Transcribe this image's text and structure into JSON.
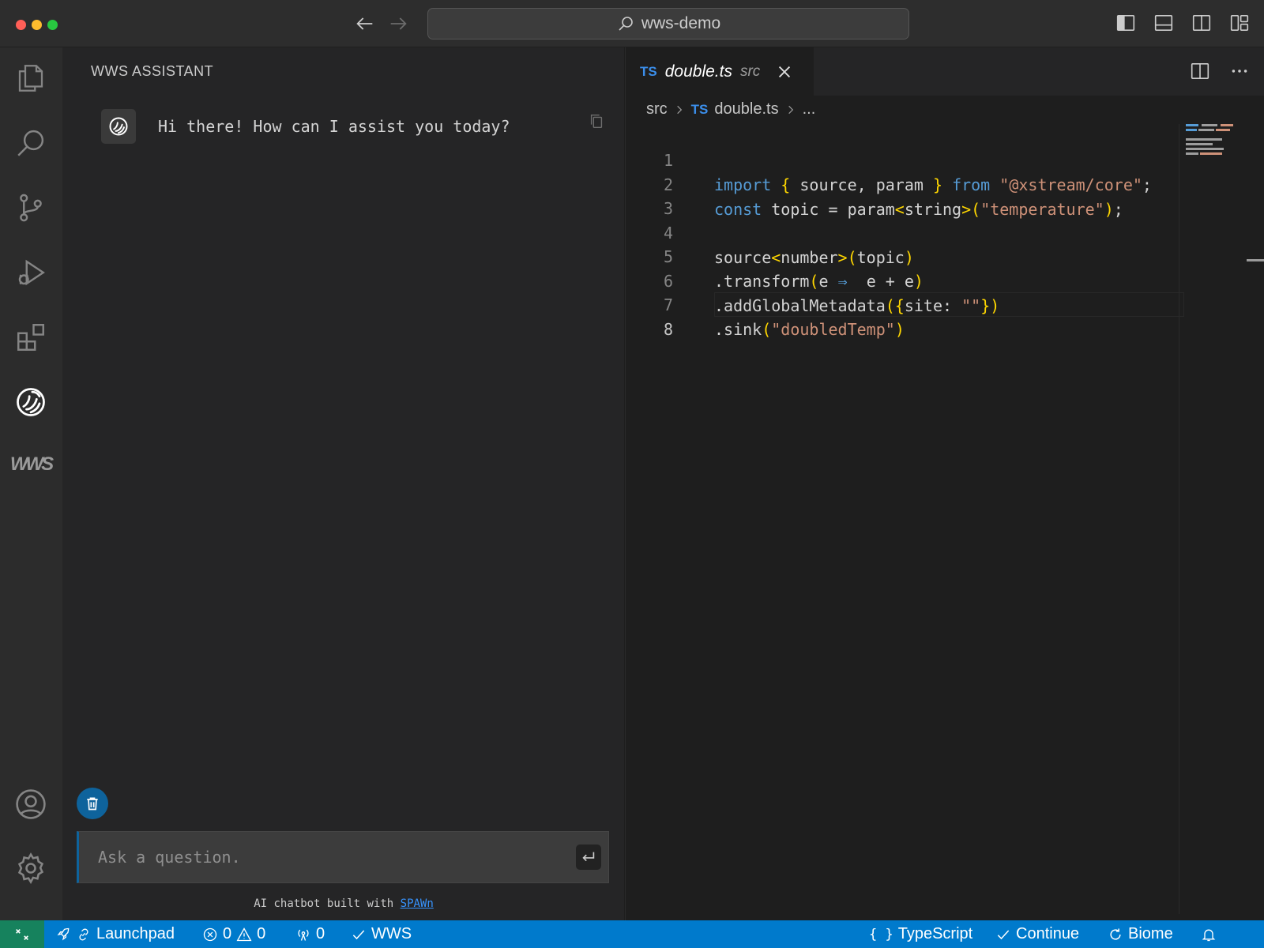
{
  "titlebar": {
    "search_text": "wws-demo"
  },
  "sidebar": {
    "title": "WWS ASSISTANT",
    "chat": {
      "bot_message": "Hi there! How can I assist you today?"
    },
    "input": {
      "placeholder": "Ask a question."
    },
    "footer": {
      "text": "AI chatbot built with ",
      "link": "SPAWn"
    }
  },
  "activitybar": {
    "wws_label": "WWS"
  },
  "editor": {
    "tab": {
      "badge": "TS",
      "filename": "double.ts",
      "dir": "src"
    },
    "breadcrumb": {
      "folder": "src",
      "badge": "TS",
      "file": "double.ts",
      "more": "..."
    },
    "code_lines": [
      {
        "num": "1"
      },
      {
        "num": "2"
      },
      {
        "num": "3"
      },
      {
        "num": "4"
      },
      {
        "num": "5"
      },
      {
        "num": "6"
      },
      {
        "num": "7"
      },
      {
        "num": "8"
      }
    ],
    "tokens": {
      "l1_import": "import",
      "l1_ob": "{",
      "l1_names": " source, param ",
      "l1_cb": "}",
      "l1_from": "from",
      "l1_str": "\"@xstream/core\"",
      "l1_semi": ";",
      "l2_const": "const",
      "l2_mid": " topic = param",
      "l2_lt": "<",
      "l2_type": "string",
      "l2_gt": ">",
      "l2_op": "(",
      "l2_str": "\"temperature\"",
      "l2_cp": ")",
      "l2_semi": ";",
      "l4_source": "source",
      "l4_lt": "<",
      "l4_type": "number",
      "l4_gt": ">",
      "l4_op": "(",
      "l4_arg": "topic",
      "l4_cp": ")",
      "l5_fn": ".transform",
      "l5_op": "(",
      "l5_e": "e ",
      "l5_arrow": "⇒",
      "l5_body": "  e + e",
      "l5_cp": ")",
      "l6_fn": ".addGlobalMetadata",
      "l6_op": "(",
      "l6_ob": "{",
      "l6_key": "site: ",
      "l6_str": "\"\"",
      "l6_cb": "}",
      "l6_cp": ")",
      "l7_fn": ".sink",
      "l7_op": "(",
      "l7_str": "\"doubledTemp\"",
      "l7_cp": ")"
    }
  },
  "statusbar": {
    "launchpad": "Launchpad",
    "errors": "0",
    "warnings": "0",
    "ports": "0",
    "wws": "WWS",
    "language": "TypeScript",
    "continue": "Continue",
    "biome": "Biome"
  },
  "colors": {
    "accent": "#007acc",
    "remote": "#16825d",
    "keyword": "#569cd6",
    "string": "#ce9178",
    "bracket": "#ffd700"
  }
}
